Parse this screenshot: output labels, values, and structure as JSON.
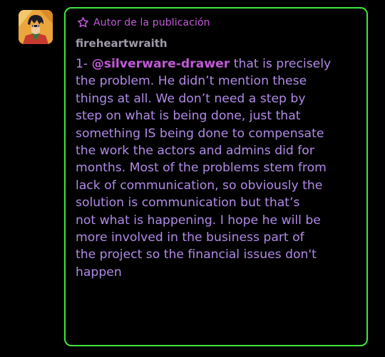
{
  "comment": {
    "author_badge": "Autor de la publicación",
    "username": "fireheartwraith",
    "message_prefix": "1- ",
    "mention": "@silverware-drawer",
    "message_lines": [
      " that is precisely",
      "the problem. He didn’t mention these",
      "things at all. We don’t need a step by",
      "step on what is being done, just that",
      "something IS being done to compensate",
      "the work the actors and admins did for",
      "months. Most of the problems stem from",
      "lack of communication, so obviously the",
      "solution is communication but that’s",
      "not what is happening. I hope he will be",
      "more involved in the business part of",
      "the project so the financial issues don't",
      "happen"
    ]
  },
  "colors": {
    "border": "#3fe63f",
    "accent": "#c25ad8",
    "text": "#b08ae6",
    "username": "#a09bab",
    "background": "#000000"
  },
  "icons": {
    "badge": "star-outline-icon",
    "avatar": "user-avatar"
  }
}
